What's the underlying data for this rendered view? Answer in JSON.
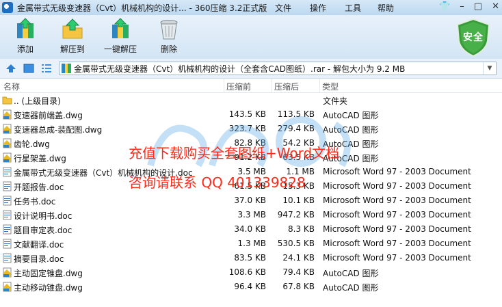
{
  "window": {
    "title": "金属带式无级变速器（Cvt）机械机构的设计... - 360压缩 3.2正式版",
    "menu": [
      "文件",
      "操作",
      "工具",
      "帮助"
    ]
  },
  "toolbar": {
    "buttons": [
      {
        "label": "添加",
        "icon": "add-archive-icon"
      },
      {
        "label": "解压到",
        "icon": "extract-to-icon"
      },
      {
        "label": "一键解压",
        "icon": "one-click-extract-icon"
      },
      {
        "label": "删除",
        "icon": "delete-trash-icon"
      }
    ],
    "security_badge": "安全"
  },
  "address": {
    "path": "金属带式无级变速器（Cvt）机械机构的设计（全套含CAD图纸）.rar - 解包大小为 9.2 MB"
  },
  "columns": {
    "name": "名称",
    "compressed_before": "压缩前",
    "compressed_after": "压缩后",
    "type": "类型"
  },
  "files": [
    {
      "name": ".. (上级目录)",
      "before": "",
      "after": "",
      "type": "文件夹",
      "icon": "folder"
    },
    {
      "name": "变速器前端盖.dwg",
      "before": "143.5 KB",
      "after": "113.5 KB",
      "type": "AutoCAD 图形",
      "icon": "dwg"
    },
    {
      "name": "变速器总成-装配图.dwg",
      "before": "323.7 KB",
      "after": "279.4 KB",
      "type": "AutoCAD 图形",
      "icon": "dwg"
    },
    {
      "name": "齿轮.dwg",
      "before": "82.8 KB",
      "after": "54.2 KB",
      "type": "AutoCAD 图形",
      "icon": "dwg"
    },
    {
      "name": "行星架盖.dwg",
      "before": "91.2 KB",
      "after": "63.5 KB",
      "type": "AutoCAD 图形",
      "icon": "dwg"
    },
    {
      "name": "金属带式无级变速器（Cvt）机械机构的设计.doc",
      "before": "3.5 MB",
      "after": "1.1 MB",
      "type": "Microsoft Word 97 - 2003 Document",
      "icon": "doc"
    },
    {
      "name": "开题报告.doc",
      "before": "61.5 KB",
      "after": "15.3 KB",
      "type": "Microsoft Word 97 - 2003 Document",
      "icon": "doc"
    },
    {
      "name": "任务书.doc",
      "before": "37.0 KB",
      "after": "10.1 KB",
      "type": "Microsoft Word 97 - 2003 Document",
      "icon": "doc"
    },
    {
      "name": "设计说明书.doc",
      "before": "3.3 MB",
      "after": "947.2 KB",
      "type": "Microsoft Word 97 - 2003 Document",
      "icon": "doc"
    },
    {
      "name": "题目审定表.doc",
      "before": "34.0 KB",
      "after": "8.3 KB",
      "type": "Microsoft Word 97 - 2003 Document",
      "icon": "doc"
    },
    {
      "name": "文献翻译.doc",
      "before": "1.3 MB",
      "after": "530.5 KB",
      "type": "Microsoft Word 97 - 2003 Document",
      "icon": "doc"
    },
    {
      "name": "摘要目录.doc",
      "before": "83.5 KB",
      "after": "24.1 KB",
      "type": "Microsoft Word 97 - 2003 Document",
      "icon": "doc"
    },
    {
      "name": "主动固定锥盘.dwg",
      "before": "108.6 KB",
      "after": "79.4 KB",
      "type": "AutoCAD 图形",
      "icon": "dwg"
    },
    {
      "name": "主动移动锥盘.dwg",
      "before": "96.4 KB",
      "after": "67.8 KB",
      "type": "AutoCAD 图形",
      "icon": "dwg"
    }
  ],
  "watermark": {
    "line1": "充值下载购买全套图纸+Word文档",
    "line2": "咨询请联系 QQ 401339828"
  },
  "colors": {
    "watermark": "#ff2a1a",
    "accent": "#1e6fc2",
    "security": "#3a9b3a"
  }
}
